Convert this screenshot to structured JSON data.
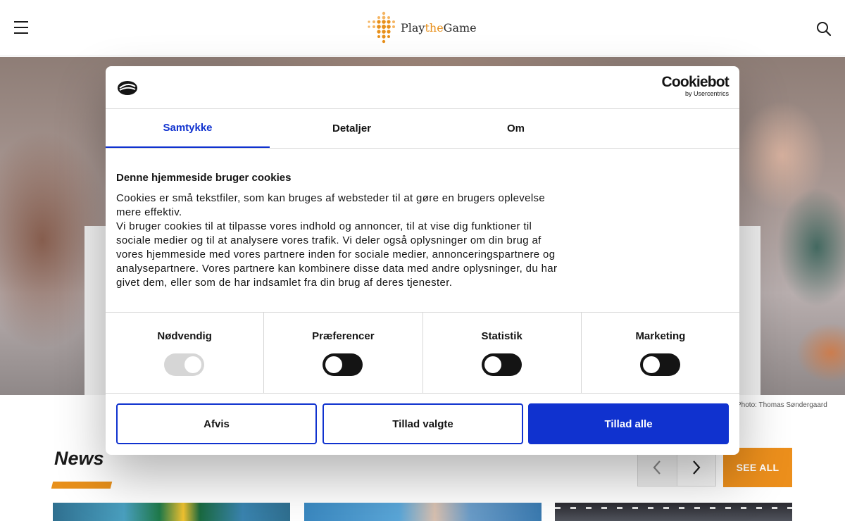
{
  "header": {
    "logo_text_play": "Play",
    "logo_text_the": "the",
    "logo_text_game": "Game"
  },
  "hero": {
    "photo_credit": "Photo: Thomas Søndergaard"
  },
  "news": {
    "title": "News",
    "see_all": "SEE ALL"
  },
  "cookie_dialog": {
    "brand_name": "Cookiebot",
    "brand_sub": "by Usercentrics",
    "tabs": [
      {
        "label": "Samtykke",
        "active": true
      },
      {
        "label": "Detaljer",
        "active": false
      },
      {
        "label": "Om",
        "active": false
      }
    ],
    "heading": "Denne hjemmeside bruger cookies",
    "paragraph": "Cookies er små tekstfiler, som kan bruges af websteder til at gøre en brugers oplevelse\nmere effektiv.\nVi bruger cookies til at tilpasse vores indhold og annoncer, til at vise dig funktioner til\nsociale medier og til at analysere vores trafik. Vi deler også oplysninger om din brug af\nvores hjemmeside med vores partnere inden for sociale medier, annonceringspartnere og\nanalysepartnere. Vores partnere kan kombinere disse data med andre oplysninger, du har\ngivet dem, eller som de har indsamlet fra din brug af deres tjenester.",
    "categories": [
      {
        "label": "Nødvendig",
        "enabled": true,
        "locked": true
      },
      {
        "label": "Præferencer",
        "enabled": false,
        "locked": false
      },
      {
        "label": "Statistik",
        "enabled": false,
        "locked": false
      },
      {
        "label": "Marketing",
        "enabled": false,
        "locked": false
      }
    ],
    "buttons": {
      "reject": "Afvis",
      "allow_selected": "Tillad valgte",
      "allow_all": "Tillad alle"
    },
    "colors": {
      "accent": "#1032cf",
      "brand_orange": "#ec8f1c"
    }
  }
}
